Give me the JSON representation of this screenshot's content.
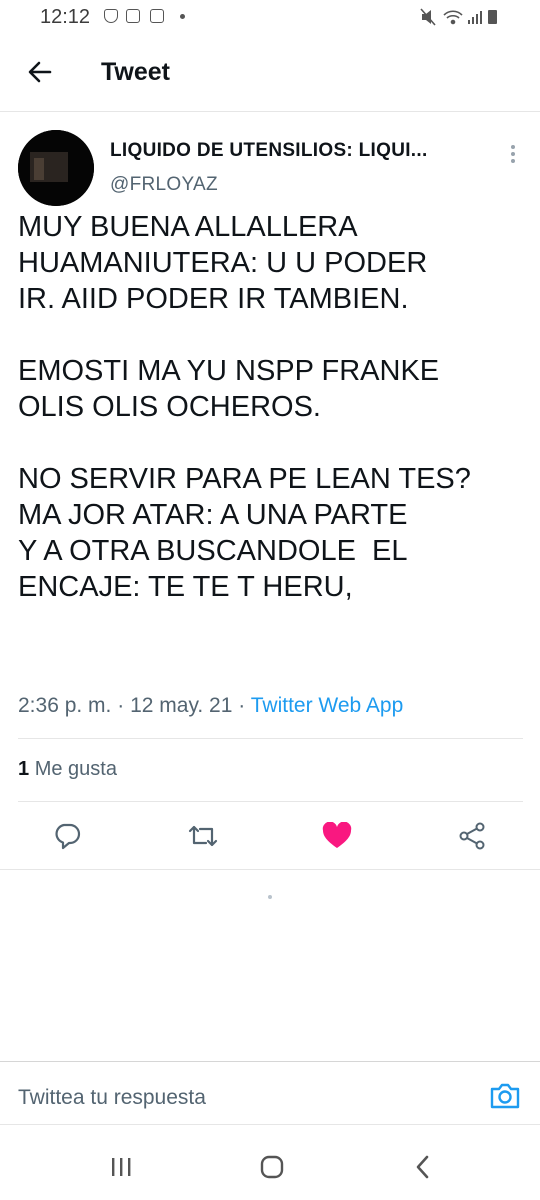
{
  "status_bar": {
    "time": "12:12"
  },
  "header": {
    "title": "Tweet"
  },
  "author": {
    "name": "LIQUIDO DE UTENSILIOS: LIQUI...",
    "handle": "@FRLOYAZ"
  },
  "tweet": {
    "paragraphs": [
      [
        "MUY BUENA ALLALLERA",
        "HUAMANIUTERA: U U PODER",
        "IR. AIID PODER IR TAMBIEN."
      ],
      [
        "EMOSTI MA YU NSPP FRANKE",
        "OLIS OLIS OCHEROS."
      ],
      [
        "NO SERVIR PARA PE LEAN TES?",
        "MA JOR ATAR: A UNA PARTE",
        "Y A OTRA BUSCANDOLE  EL",
        "ENCAJE: TE TE T HERU,"
      ]
    ],
    "time": "2:36 p. m.",
    "date": "12 may. 21",
    "separator": "·",
    "source": "Twitter Web App",
    "like_count": "1",
    "like_label": "Me gusta",
    "liked": true
  },
  "icons": {
    "reply": "reply-icon",
    "retweet": "retweet-icon",
    "like": "heart-icon",
    "share": "share-icon",
    "camera": "camera-icon"
  },
  "colors": {
    "accent": "#1d9bf0",
    "like": "#f91880",
    "secondary": "#536471"
  },
  "reply_box": {
    "placeholder": "Twittea tu respuesta"
  }
}
